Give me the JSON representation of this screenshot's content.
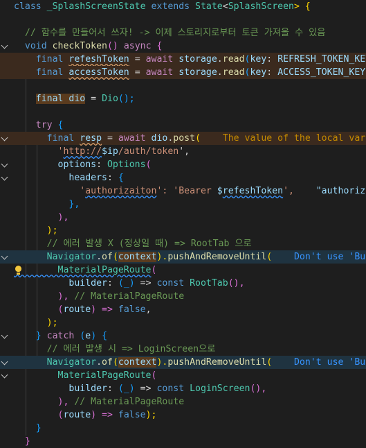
{
  "editor": {
    "language": "dart",
    "lines": [
      {
        "gutter": "",
        "parts": [
          [
            "class ",
            "k"
          ],
          [
            "_SplashScreenState ",
            "t"
          ],
          [
            "extends ",
            "k"
          ],
          [
            "State",
            "t"
          ],
          [
            "<",
            "p"
          ],
          [
            "SplashScreen",
            "t"
          ],
          [
            "> {",
            "y"
          ]
        ]
      },
      {
        "gutter": "",
        "parts": []
      },
      {
        "gutter": "",
        "parts": [
          [
            "  // 함수를 만들어서 쓰자! -> 이제 스토리지로부터 토큰 가져올 수 있음",
            "c"
          ]
        ]
      },
      {
        "gutter": "chevron",
        "parts": [
          [
            "  void ",
            "k"
          ],
          [
            "checkToken",
            "f"
          ],
          [
            "() ",
            "pk"
          ],
          [
            "async ",
            "kc"
          ],
          [
            "{",
            "pk"
          ]
        ]
      },
      {
        "gutter": "",
        "parts": [
          [
            "    final ",
            "k"
          ],
          [
            "refeshToken",
            "v sq"
          ],
          [
            " = ",
            "p"
          ],
          [
            "await ",
            "kc"
          ],
          [
            "storage",
            "v"
          ],
          [
            ".",
            "p"
          ],
          [
            "read",
            "f"
          ],
          [
            "(",
            "bl"
          ],
          [
            "key",
            "v"
          ],
          [
            ": ",
            "p"
          ],
          [
            "REFRESH_TOKEN_KEY",
            "v"
          ],
          [
            ");",
            "bl"
          ]
        ],
        "hl": "warn"
      },
      {
        "gutter": "",
        "parts": [
          [
            "    final ",
            "k"
          ],
          [
            "accessToken",
            "v sq"
          ],
          [
            " = ",
            "p"
          ],
          [
            "await ",
            "kc"
          ],
          [
            "storage",
            "v"
          ],
          [
            ".",
            "p"
          ],
          [
            "read",
            "f"
          ],
          [
            "(",
            "bl"
          ],
          [
            "key",
            "v"
          ],
          [
            ": ",
            "p"
          ],
          [
            "ACCESS_TOKEN_KEY",
            "v"
          ],
          [
            ");",
            "bl"
          ]
        ],
        "hl": "warn"
      },
      {
        "gutter": "",
        "parts": []
      },
      {
        "gutter": "",
        "parts": [
          [
            "    ",
            "p"
          ],
          [
            "final dio",
            "v box"
          ],
          [
            " = ",
            "p"
          ],
          [
            "Dio",
            "t"
          ],
          [
            "();",
            "bl"
          ]
        ]
      },
      {
        "gutter": "",
        "parts": []
      },
      {
        "gutter": "",
        "parts": [
          [
            "    try ",
            "kc"
          ],
          [
            "{",
            "bl"
          ]
        ]
      },
      {
        "gutter": "chevron",
        "parts": [
          [
            "      final ",
            "k"
          ],
          [
            "resp",
            "v sq"
          ],
          [
            " = ",
            "p"
          ],
          [
            "await ",
            "kc"
          ],
          [
            "dio",
            "v"
          ],
          [
            ".",
            "p"
          ],
          [
            "post",
            "f"
          ],
          [
            "(",
            "y"
          ],
          [
            "    The value of the local variab",
            "hint"
          ]
        ],
        "hl": "warn"
      },
      {
        "gutter": "",
        "parts": [
          [
            "        '",
            "s"
          ],
          [
            "http://",
            "s sqb"
          ],
          [
            "$ip",
            "v"
          ],
          [
            "/auth/token",
            "s"
          ],
          [
            "',",
            "p"
          ]
        ]
      },
      {
        "gutter": "chevron",
        "parts": [
          [
            "        options",
            "v"
          ],
          [
            ": ",
            "p"
          ],
          [
            "Options",
            "t"
          ],
          [
            "(",
            "pk"
          ]
        ]
      },
      {
        "gutter": "chevron",
        "parts": [
          [
            "          headers",
            "v"
          ],
          [
            ": ",
            "p"
          ],
          [
            "{",
            "bl"
          ]
        ]
      },
      {
        "gutter": "",
        "parts": [
          [
            "            '",
            "s"
          ],
          [
            "authorizaiton",
            "s sqb"
          ],
          [
            "': ",
            "s"
          ],
          [
            "'Bearer ",
            "s"
          ],
          [
            "$",
            "v"
          ],
          [
            "refeshToken",
            "v sqb"
          ],
          [
            "',",
            "s"
          ],
          [
            "    \"authorizait",
            "v"
          ]
        ]
      },
      {
        "gutter": "",
        "parts": [
          [
            "          },",
            "bl"
          ]
        ]
      },
      {
        "gutter": "",
        "parts": [
          [
            "        ),",
            "pk"
          ]
        ]
      },
      {
        "gutter": "",
        "parts": [
          [
            "      );",
            "y"
          ]
        ]
      },
      {
        "gutter": "",
        "parts": [
          [
            "      // 에러 발생 X (정상일 때) => RootTab 으로",
            "c"
          ]
        ]
      },
      {
        "gutter": "chevron",
        "parts": [
          [
            "      Navigator",
            "t"
          ],
          [
            ".",
            "p"
          ],
          [
            "of",
            "f"
          ],
          [
            "(",
            "y"
          ],
          [
            "context",
            "v box"
          ],
          [
            ").",
            "y"
          ],
          [
            "pushAndRemoveUntil",
            "f"
          ],
          [
            "(",
            "y"
          ],
          [
            "    Don't use 'Build",
            "hint2"
          ]
        ],
        "hl": "info"
      },
      {
        "gutter": "bulb",
        "parts": [
          [
            "        MaterialPageRoute",
            "t sqb"
          ],
          [
            "(",
            "pk"
          ]
        ]
      },
      {
        "gutter": "",
        "parts": [
          [
            "          builder",
            "v"
          ],
          [
            ": ",
            "p"
          ],
          [
            "(_)",
            "bl"
          ],
          [
            " => ",
            "p"
          ],
          [
            "const ",
            "k"
          ],
          [
            "RootTab",
            "t"
          ],
          [
            "(),",
            "pk"
          ]
        ]
      },
      {
        "gutter": "",
        "parts": [
          [
            "        ),",
            "pk"
          ],
          [
            " // MaterialPageRoute",
            "c"
          ]
        ]
      },
      {
        "gutter": "",
        "parts": [
          [
            "        (",
            "pk"
          ],
          [
            "route",
            "v"
          ],
          [
            ") => ",
            "pk"
          ],
          [
            "false",
            "k"
          ],
          [
            ",",
            "p"
          ]
        ]
      },
      {
        "gutter": "",
        "parts": [
          [
            "      );",
            "y"
          ]
        ]
      },
      {
        "gutter": "chevron",
        "parts": [
          [
            "    } ",
            "bl"
          ],
          [
            "catch ",
            "kc"
          ],
          [
            "(",
            "bl"
          ],
          [
            "e",
            "v"
          ],
          [
            ") {",
            "bl"
          ]
        ]
      },
      {
        "gutter": "",
        "parts": [
          [
            "      // 에러 발생 시 => LoginScreen으로",
            "c"
          ]
        ]
      },
      {
        "gutter": "chevron",
        "parts": [
          [
            "      Navigator",
            "t"
          ],
          [
            ".",
            "p"
          ],
          [
            "of",
            "f"
          ],
          [
            "(",
            "y"
          ],
          [
            "context",
            "v box"
          ],
          [
            ").",
            "y"
          ],
          [
            "pushAndRemoveUntil",
            "f"
          ],
          [
            "(",
            "y"
          ],
          [
            "    Don't use 'Build",
            "hint2"
          ]
        ],
        "hl": "info"
      },
      {
        "gutter": "chevron",
        "parts": [
          [
            "        MaterialPageRoute",
            "t"
          ],
          [
            "(",
            "pk"
          ]
        ]
      },
      {
        "gutter": "",
        "parts": [
          [
            "          builder",
            "v"
          ],
          [
            ": ",
            "p"
          ],
          [
            "(_)",
            "bl"
          ],
          [
            " => ",
            "p"
          ],
          [
            "const ",
            "k"
          ],
          [
            "LoginScreen",
            "t"
          ],
          [
            "(),",
            "pk"
          ]
        ]
      },
      {
        "gutter": "",
        "parts": [
          [
            "        ),",
            "pk"
          ],
          [
            " // MaterialPageRoute",
            "c"
          ]
        ]
      },
      {
        "gutter": "",
        "parts": [
          [
            "        (",
            "pk"
          ],
          [
            "route",
            "v"
          ],
          [
            ") => ",
            "pk"
          ],
          [
            "false",
            "k"
          ],
          [
            ");",
            "y"
          ]
        ]
      },
      {
        "gutter": "",
        "parts": [
          [
            "    }",
            "bl"
          ]
        ]
      },
      {
        "gutter": "",
        "parts": [
          [
            "  }",
            "pk"
          ]
        ]
      }
    ]
  }
}
